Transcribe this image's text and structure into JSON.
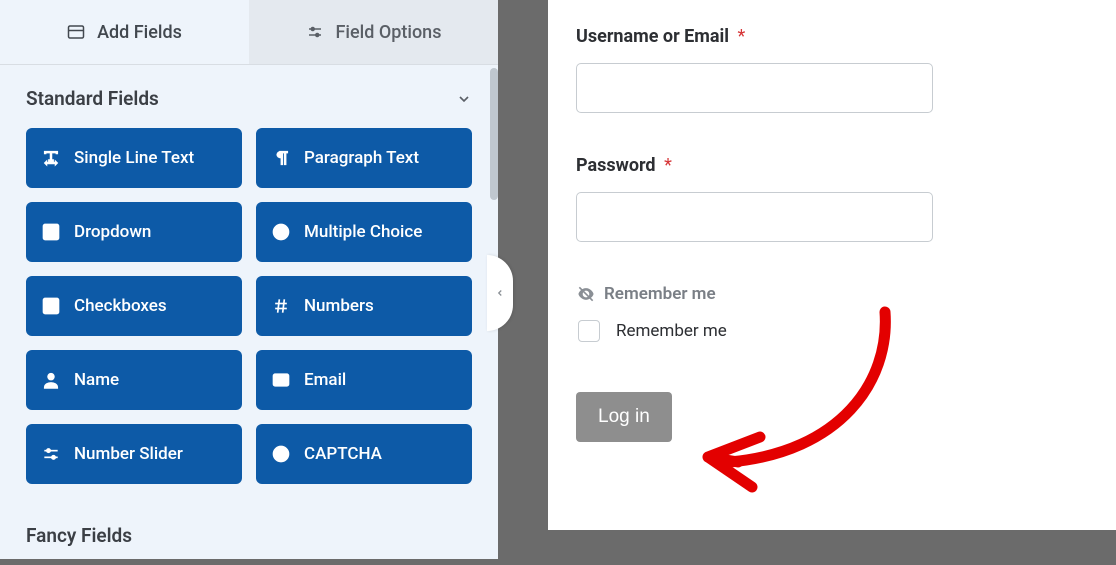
{
  "tabs": {
    "add_fields": "Add Fields",
    "field_options": "Field Options"
  },
  "sections": {
    "standard": {
      "title": "Standard Fields",
      "fields": [
        {
          "icon": "text-width",
          "label": "Single Line Text"
        },
        {
          "icon": "paragraph",
          "label": "Paragraph Text"
        },
        {
          "icon": "caret-square",
          "label": "Dropdown"
        },
        {
          "icon": "dot-circle",
          "label": "Multiple Choice"
        },
        {
          "icon": "check-square",
          "label": "Checkboxes"
        },
        {
          "icon": "hashtag",
          "label": "Numbers"
        },
        {
          "icon": "user",
          "label": "Name"
        },
        {
          "icon": "envelope",
          "label": "Email"
        },
        {
          "icon": "sliders",
          "label": "Number Slider"
        },
        {
          "icon": "question-circle",
          "label": "CAPTCHA"
        }
      ]
    },
    "fancy": {
      "title": "Fancy Fields"
    }
  },
  "preview": {
    "username_label": "Username or Email",
    "password_label": "Password",
    "remember_heading": "Remember me",
    "remember_label": "Remember me",
    "submit_label": "Log in",
    "required_marker": "*"
  }
}
